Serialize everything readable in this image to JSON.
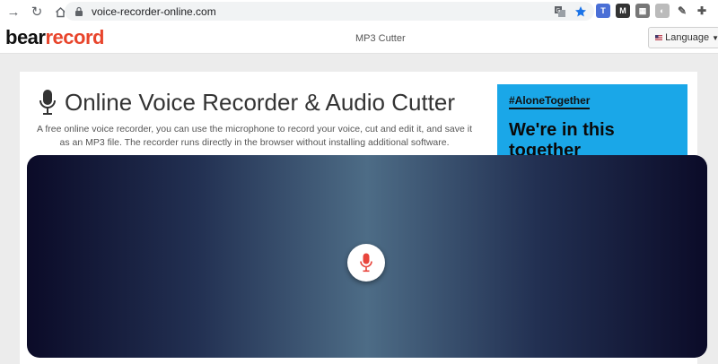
{
  "browser": {
    "url": "voice-recorder-online.com"
  },
  "header": {
    "logo_part1": "bear",
    "logo_part2": "record",
    "nav_label": "MP3 Cutter",
    "language_label": "Language"
  },
  "main": {
    "title": "Online Voice Recorder & Audio Cutter",
    "description": "A free online voice recorder, you can use the microphone to record your voice, cut and edit it, and save it as an MP3 file. The recorder runs directly in the browser without installing additional software."
  },
  "ad": {
    "hashtag": "#AloneTogether",
    "headline": "We're in this together"
  },
  "colors": {
    "logo_accent": "#e8452c",
    "ad_background": "#1aa7e8",
    "record_icon": "#e8453c"
  },
  "icons": {
    "back": "arrow-right-icon",
    "reload": "reload-icon",
    "home": "home-icon",
    "lock": "lock-icon",
    "translate": "translate-icon",
    "bookmark": "star-icon",
    "record": "microphone-icon"
  }
}
